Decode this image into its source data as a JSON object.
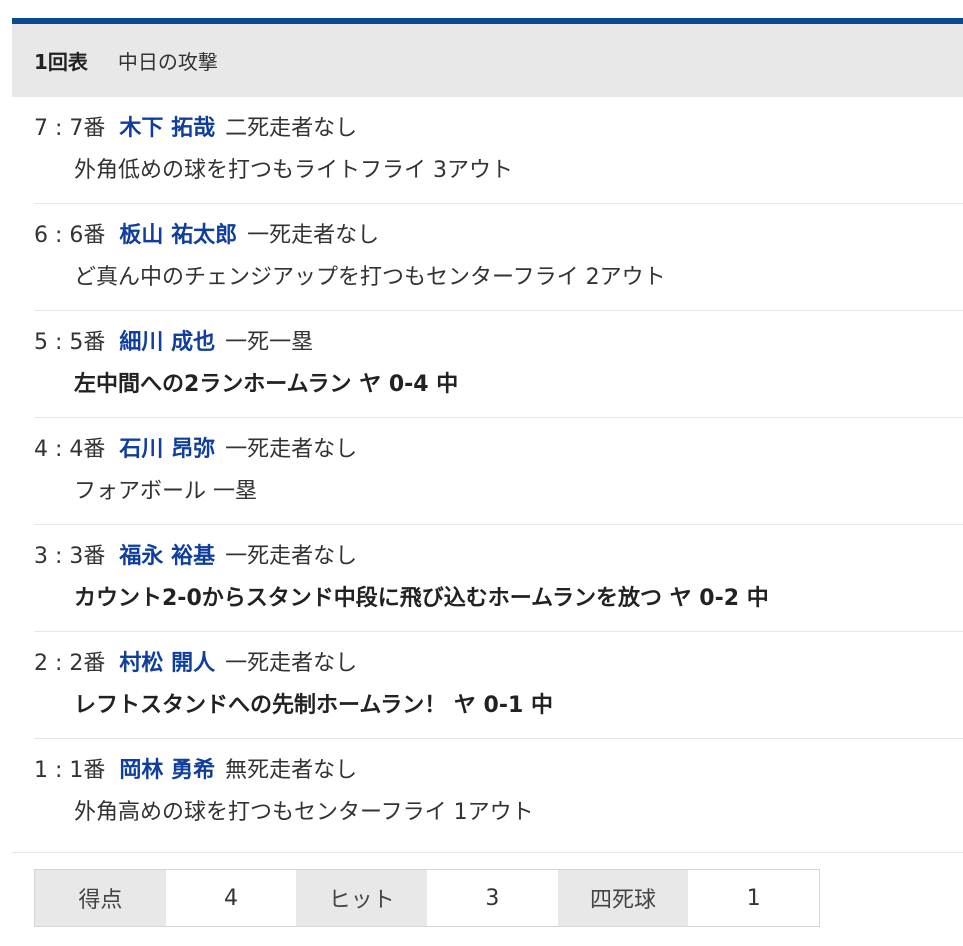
{
  "header": {
    "inning": "1回表",
    "team": "中日の攻撃"
  },
  "plays": [
    {
      "seq": "7",
      "order": "7番",
      "player": "木下 拓哉",
      "situation": "二死走者なし",
      "result": "外角低めの球を打つもライトフライ 3アウト",
      "bold": false
    },
    {
      "seq": "6",
      "order": "6番",
      "player": "板山 祐太郎",
      "situation": "一死走者なし",
      "result": "ど真ん中のチェンジアップを打つもセンターフライ 2アウト",
      "bold": false
    },
    {
      "seq": "5",
      "order": "5番",
      "player": "細川 成也",
      "situation": "一死一塁",
      "result": "左中間への2ランホームラン ヤ 0-4 中",
      "bold": true
    },
    {
      "seq": "4",
      "order": "4番",
      "player": "石川 昂弥",
      "situation": "一死走者なし",
      "result": "フォアボール 一塁",
      "bold": false
    },
    {
      "seq": "3",
      "order": "3番",
      "player": "福永 裕基",
      "situation": "一死走者なし",
      "result": "カウント2-0からスタンド中段に飛び込むホームランを放つ ヤ 0-2 中",
      "bold": true
    },
    {
      "seq": "2",
      "order": "2番",
      "player": "村松 開人",
      "situation": "一死走者なし",
      "result": "レフトスタンドへの先制ホームラン！ ヤ 0-1 中",
      "bold": true
    },
    {
      "seq": "1",
      "order": "1番",
      "player": "岡林 勇希",
      "situation": "無死走者なし",
      "result": "外角高めの球を打つもセンターフライ 1アウト",
      "bold": false
    }
  ],
  "stats": [
    {
      "label": "得点",
      "value": "4"
    },
    {
      "label": "ヒット",
      "value": "3"
    },
    {
      "label": "四死球",
      "value": "1"
    }
  ],
  "colors": {
    "accent": "#0b4a8f",
    "player": "#0f3e9e",
    "header_bg": "#e8e8e8"
  }
}
